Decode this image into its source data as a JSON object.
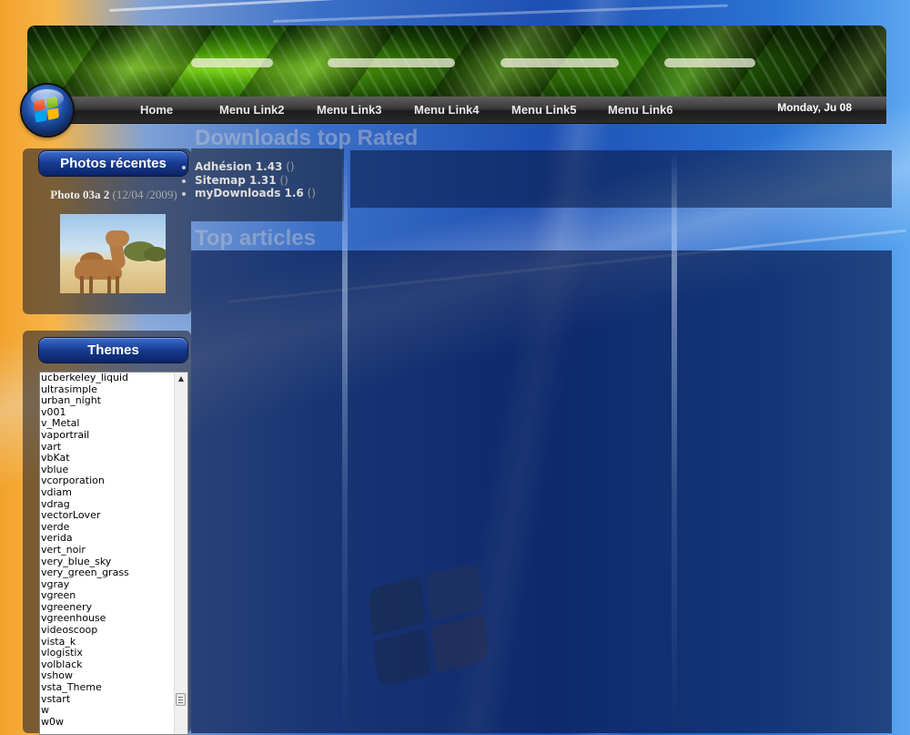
{
  "nav": {
    "items": [
      {
        "label": "Home"
      },
      {
        "label": "Menu Link2"
      },
      {
        "label": "Menu Link3"
      },
      {
        "label": "Menu Link4"
      },
      {
        "label": "Menu Link5"
      },
      {
        "label": "Menu Link6"
      }
    ],
    "date": "Monday, Ju 08"
  },
  "sidebar": {
    "photos": {
      "title": "Photos récentes",
      "caption_name": "Photo 03a 2",
      "caption_date": "(12/04 /2009)"
    },
    "themes": {
      "title": "Themes",
      "items": [
        "ucberkeley_liquid",
        "ultrasimple",
        "urban_night",
        "v001",
        "v_Metal",
        "vaportrail",
        "vart",
        "vbKat",
        "vblue",
        "vcorporation",
        "vdiam",
        "vdrag",
        "vectorLover",
        "verde",
        "verida",
        "vert_noir",
        "very_blue_sky",
        "very_green_grass",
        "vgray",
        "vgreen",
        "vgreenery",
        "vgreenhouse",
        "videoscoop",
        "vista_k",
        "vlogistix",
        "volblack",
        "vshow",
        "vsta_Theme",
        "vstart",
        "w",
        "w0w"
      ]
    }
  },
  "main": {
    "downloads": {
      "heading": "Downloads top Rated",
      "items": [
        {
          "name": "Adhésion 1.43",
          "count": "()"
        },
        {
          "name": "Sitemap 1.31",
          "count": "()"
        },
        {
          "name": "myDownloads 1.6",
          "count": "()"
        }
      ]
    },
    "articles": {
      "heading": "Top articles"
    }
  },
  "colors": {
    "nav_bar": "#2b2b2b",
    "side_title": "#163a8f",
    "background_blue": "#1e4fb3",
    "background_orange": "#f3a32c"
  }
}
